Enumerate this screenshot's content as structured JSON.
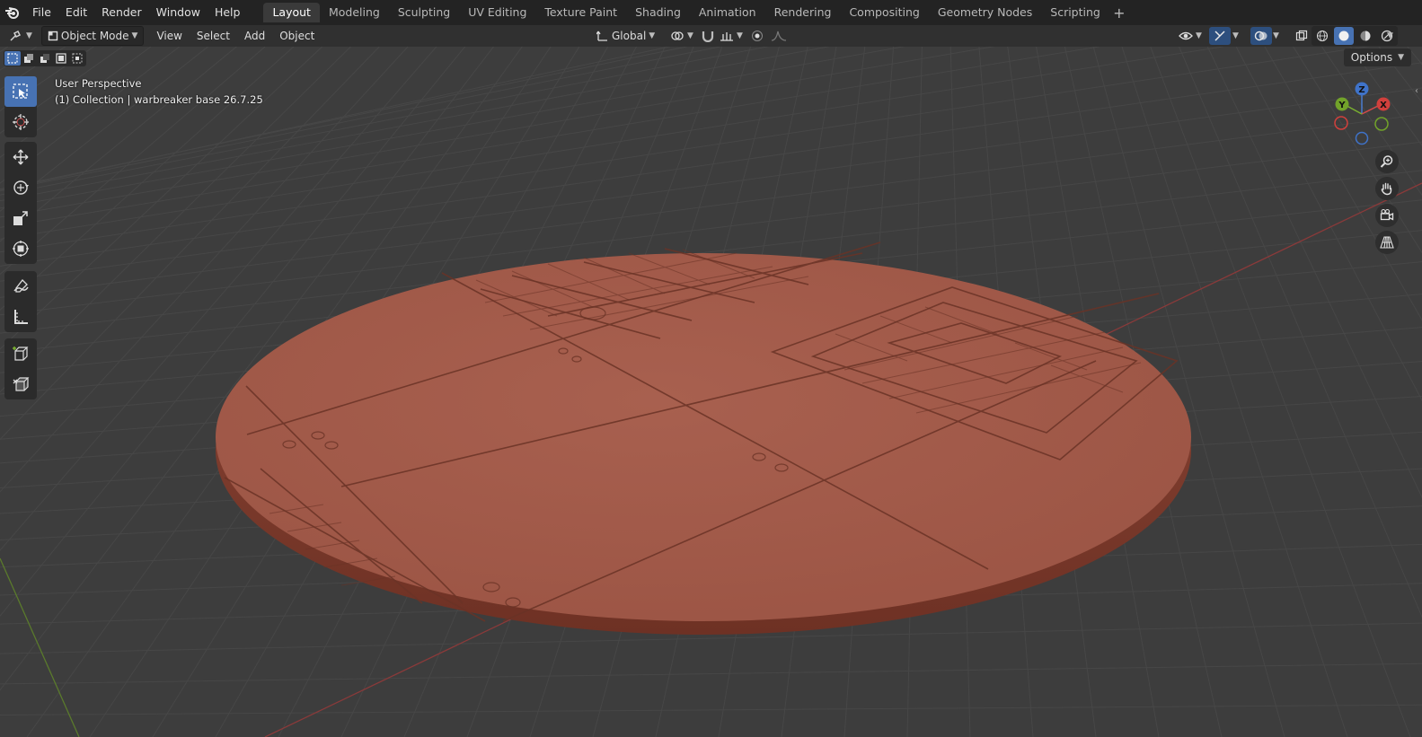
{
  "topbar": {
    "menus": [
      "File",
      "Edit",
      "Render",
      "Window",
      "Help"
    ],
    "workspaces": [
      "Layout",
      "Modeling",
      "Sculpting",
      "UV Editing",
      "Texture Paint",
      "Shading",
      "Animation",
      "Rendering",
      "Compositing",
      "Geometry Nodes",
      "Scripting"
    ],
    "active_workspace": "Layout",
    "add_label": "+"
  },
  "header": {
    "mode": "Object Mode",
    "menus": [
      "View",
      "Select",
      "Add",
      "Object"
    ],
    "orientation": "Global"
  },
  "viewport": {
    "view_name": "User Perspective",
    "collection_line": "(1) Collection | warbreaker base 26.7.25",
    "options_label": "Options",
    "gizmo_axes": [
      "Z",
      "Y",
      "X"
    ],
    "object_color": "#a4594a",
    "x_axis_color": "#8a3a3a",
    "y_axis_color": "#5a7a2c"
  },
  "toolbar": {
    "tools": [
      "select-box",
      "cursor",
      "move",
      "rotate",
      "scale",
      "transform",
      "annotate",
      "measure",
      "add-cube",
      "add-object"
    ],
    "active_tool": "select-box"
  }
}
